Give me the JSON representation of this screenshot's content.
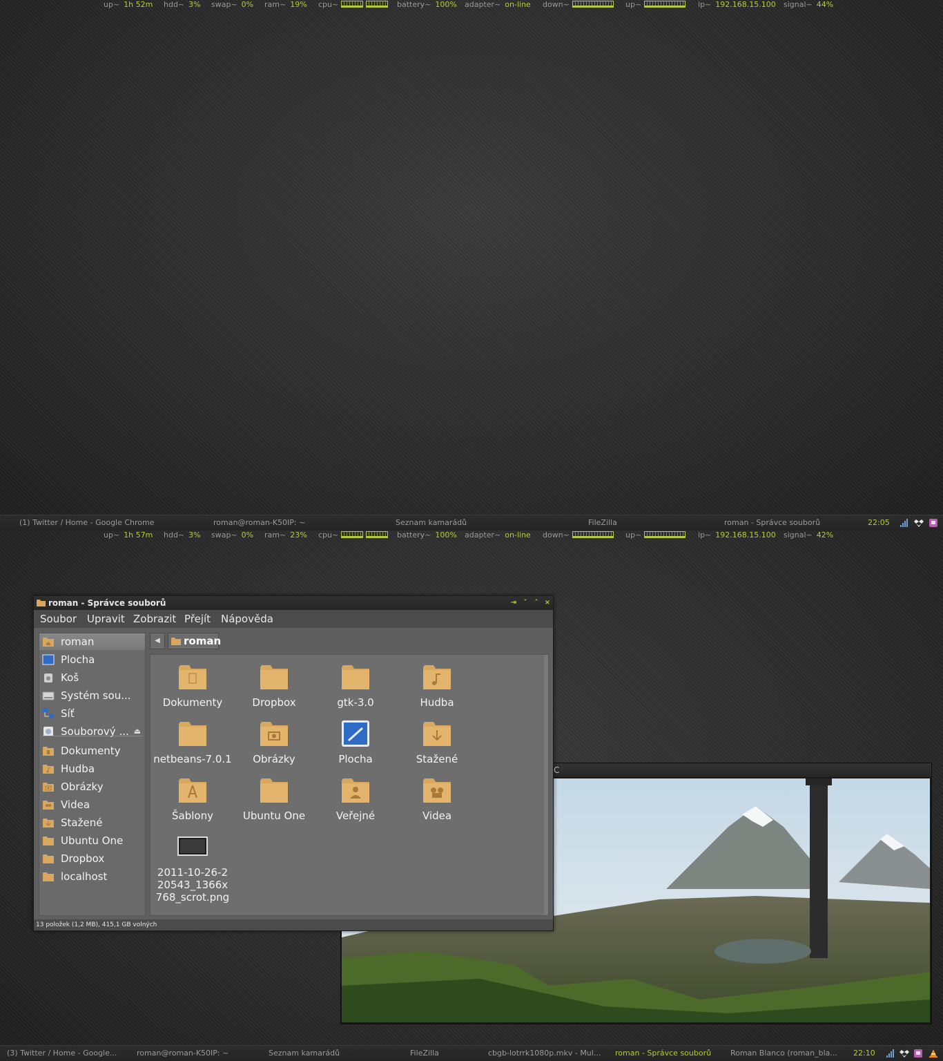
{
  "screens": [
    {
      "status": {
        "uptime_label": "up~",
        "uptime": "1h 52m",
        "hdd_label": "hdd~",
        "hdd": "3%",
        "swap_label": "swap~",
        "swap": "0%",
        "ram_label": "ram~",
        "ram": "19%",
        "cpu_label": "cpu~",
        "battery_label": "battery~",
        "battery": "100%",
        "adapter_label": "adapter~",
        "adapter": "on-line",
        "down_label": "down~",
        "up_label": "up~",
        "ip_label": "ip~",
        "ip": "192.168.15.100",
        "signal_label": "signal~",
        "signal": "44%"
      },
      "taskbar": {
        "tasks": [
          "(1) Twitter / Home - Google Chrome",
          "roman@roman-K50IP: ~",
          "Seznam kamarádů",
          "FileZilla",
          "roman - Správce souborů"
        ],
        "clock": "22:05"
      }
    },
    {
      "status": {
        "uptime_label": "up~",
        "uptime": "1h 57m",
        "hdd_label": "hdd~",
        "hdd": "3%",
        "swap_label": "swap~",
        "swap": "0%",
        "ram_label": "ram~",
        "ram": "23%",
        "cpu_label": "cpu~",
        "battery_label": "battery~",
        "battery": "100%",
        "adapter_label": "adapter~",
        "adapter": "on-line",
        "down_label": "down~",
        "up_label": "up~",
        "ip_label": "ip~",
        "ip": "192.168.15.100",
        "signal_label": "signal~",
        "signal": "42%"
      },
      "taskbar": {
        "tasks": [
          "(3) Twitter / Home - Google...",
          "roman@roman-K50IP: ~",
          "Seznam kamarádů",
          "FileZilla",
          "cbgb-lotrrk1080p.mkv - Mul...",
          "roman - Správce souborů",
          "Roman Blanco (roman_bla..."
        ],
        "clock": "22:10"
      }
    }
  ],
  "file_manager": {
    "title": "roman - Správce souborů",
    "menu": [
      "Soubor",
      "Upravit",
      "Zobrazit",
      "Přejít",
      "Nápověda"
    ],
    "sidebar": [
      {
        "label": "roman",
        "icon": "home-folder-icon"
      },
      {
        "label": "Plocha",
        "icon": "desktop-icon"
      },
      {
        "label": "Koš",
        "icon": "trash-icon"
      },
      {
        "label": "Systém sou...",
        "icon": "filesystem-icon"
      },
      {
        "label": "Síť",
        "icon": "network-icon"
      },
      {
        "label": "Souborový ...",
        "icon": "drive-icon"
      },
      {
        "label": "Dokumenty",
        "icon": "documents-folder-icon"
      },
      {
        "label": "Hudba",
        "icon": "music-folder-icon"
      },
      {
        "label": "Obrázky",
        "icon": "pictures-folder-icon"
      },
      {
        "label": "Videa",
        "icon": "videos-folder-icon"
      },
      {
        "label": "Stažené",
        "icon": "downloads-folder-icon"
      },
      {
        "label": "Ubuntu One",
        "icon": "folder-icon"
      },
      {
        "label": "Dropbox",
        "icon": "folder-icon"
      },
      {
        "label": "localhost",
        "icon": "folder-icon"
      }
    ],
    "path": "roman",
    "files": [
      {
        "name": "Dokumenty",
        "icon": "documents-folder-icon"
      },
      {
        "name": "Dropbox",
        "icon": "folder-icon"
      },
      {
        "name": "gtk-3.0",
        "icon": "folder-icon"
      },
      {
        "name": "Hudba",
        "icon": "music-folder-icon"
      },
      {
        "name": "netbeans-7.0.1",
        "icon": "folder-icon"
      },
      {
        "name": "Obrázky",
        "icon": "pictures-folder-icon"
      },
      {
        "name": "Plocha",
        "icon": "desktop-icon"
      },
      {
        "name": "Stažené",
        "icon": "downloads-folder-icon"
      },
      {
        "name": "Šablony",
        "icon": "templates-folder-icon"
      },
      {
        "name": "Ubuntu One",
        "icon": "folder-icon"
      },
      {
        "name": "Veřejné",
        "icon": "public-folder-icon"
      },
      {
        "name": "Videa",
        "icon": "videos-folder-icon"
      },
      {
        "name": "2011-10-26-220543_1366x768_scrot.png",
        "icon": "image-file-icon"
      }
    ],
    "status": "13 položek (1,2 MB), 415,1 GB volných"
  },
  "video_window": {
    "title_fragment": "C"
  },
  "colors": {
    "accent": "#b5cc3a",
    "folder": "#d9a85e"
  }
}
